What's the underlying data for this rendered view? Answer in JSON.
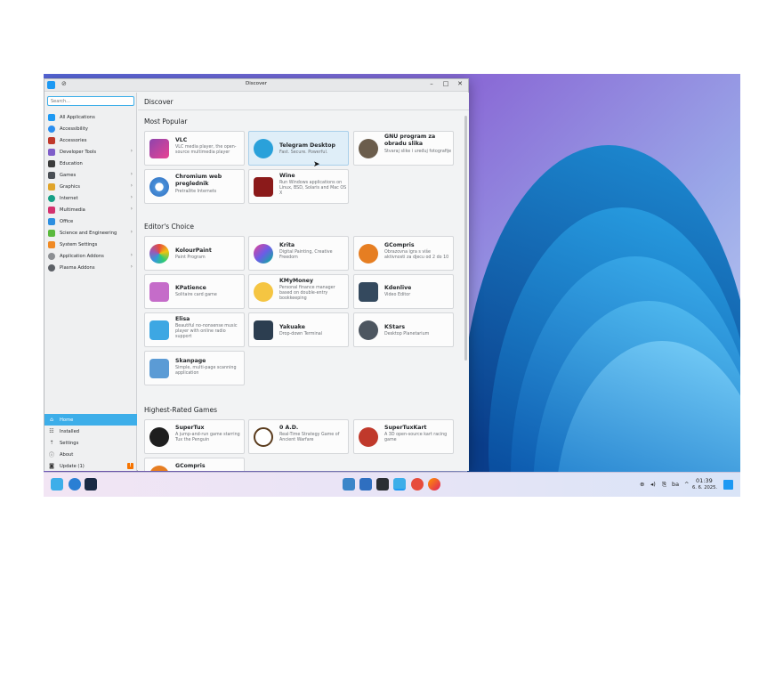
{
  "window": {
    "title": "Discover"
  },
  "search": {
    "placeholder": "Search..."
  },
  "categories": [
    {
      "label": "All Applications",
      "color": "#1d99f3",
      "chevron": false
    },
    {
      "label": "Accessibility",
      "color": "#2a8ef0",
      "chevron": false
    },
    {
      "label": "Accessories",
      "color": "#c0392b",
      "chevron": false
    },
    {
      "label": "Developer Tools",
      "color": "#7f5ec9",
      "chevron": true
    },
    {
      "label": "Education",
      "color": "#3b3b3b",
      "chevron": false
    },
    {
      "label": "Games",
      "color": "#4a4f55",
      "chevron": true
    },
    {
      "label": "Graphics",
      "color": "#e0a42a",
      "chevron": true
    },
    {
      "label": "Internet",
      "color": "#16a085",
      "chevron": true
    },
    {
      "label": "Multimedia",
      "color": "#d4326e",
      "chevron": true
    },
    {
      "label": "Office",
      "color": "#2d8fe0",
      "chevron": false
    },
    {
      "label": "Science and Engineering",
      "color": "#5ab93d",
      "chevron": true
    },
    {
      "label": "System Settings",
      "color": "#f08a24",
      "chevron": false
    },
    {
      "label": "Application Addons",
      "color": "#8c8f93",
      "chevron": true
    },
    {
      "label": "Plasma Addons",
      "color": "#5c6066",
      "chevron": true
    }
  ],
  "nav": {
    "home": "Home",
    "installed": "Installed",
    "settings": "Settings",
    "about": "About",
    "update": "Update (1)",
    "update_badge": "!"
  },
  "main": {
    "header": "Discover",
    "sections": [
      "Most Popular",
      "Editor's Choice",
      "Highest-Rated Games"
    ]
  },
  "apps": {
    "vlc": {
      "name": "VLC",
      "desc": "VLC media player, the open-source multimedia player"
    },
    "telegram": {
      "name": "Telegram Desktop",
      "desc": "Fast. Secure. Powerful."
    },
    "gimp": {
      "name": "GNU program za obradu slika",
      "desc": "Stvaraj slike i uređuj fotografije"
    },
    "chromium": {
      "name": "Chromium web preglednik",
      "desc": "Pretražite Internets"
    },
    "wine": {
      "name": "Wine",
      "desc": "Run Windows applications on Linux, BSD, Solaris and Mac OS X"
    },
    "kolourpaint": {
      "name": "KolourPaint",
      "desc": "Paint Program"
    },
    "krita": {
      "name": "Krita",
      "desc": "Digital Painting, Creative Freedom"
    },
    "gcompris": {
      "name": "GCompris",
      "desc": "Obrazovna igra s više aktivnosti za djecu od 2 do 10"
    },
    "kpatience": {
      "name": "KPatience",
      "desc": "Solitaire card game"
    },
    "kmymoney": {
      "name": "KMyMoney",
      "desc": "Personal finance manager based on double-entry bookkeeping"
    },
    "kdenlive": {
      "name": "Kdenlive",
      "desc": "Video Editor"
    },
    "elisa": {
      "name": "Elisa",
      "desc": "Beautiful no-nonsense music player with online radio support"
    },
    "yakuake": {
      "name": "Yakuake",
      "desc": "Drop-down Terminal"
    },
    "kstars": {
      "name": "KStars",
      "desc": "Desktop Planetarium"
    },
    "skanpage": {
      "name": "Skanpage",
      "desc": "Simple, multi-page scanning application"
    },
    "supertux": {
      "name": "SuperTux",
      "desc": "A jump-and-run game starring Tux the Penguin"
    },
    "zeroad": {
      "name": "0 A.D.",
      "desc": "Real-Time Strategy Game of Ancient Warfare"
    },
    "supertuxkart": {
      "name": "SuperTuxKart",
      "desc": "A 3D open-source kart racing game"
    },
    "gcompris2": {
      "name": "GCompris"
    }
  },
  "taskbar": {
    "keyboard_layout": "ba",
    "clock_time": "01:39",
    "clock_date": "6. 6. 2025.",
    "tray_icons": [
      "update-notifier-icon",
      "volume-icon",
      "clipboard-icon",
      "tray-expand-icon"
    ]
  }
}
